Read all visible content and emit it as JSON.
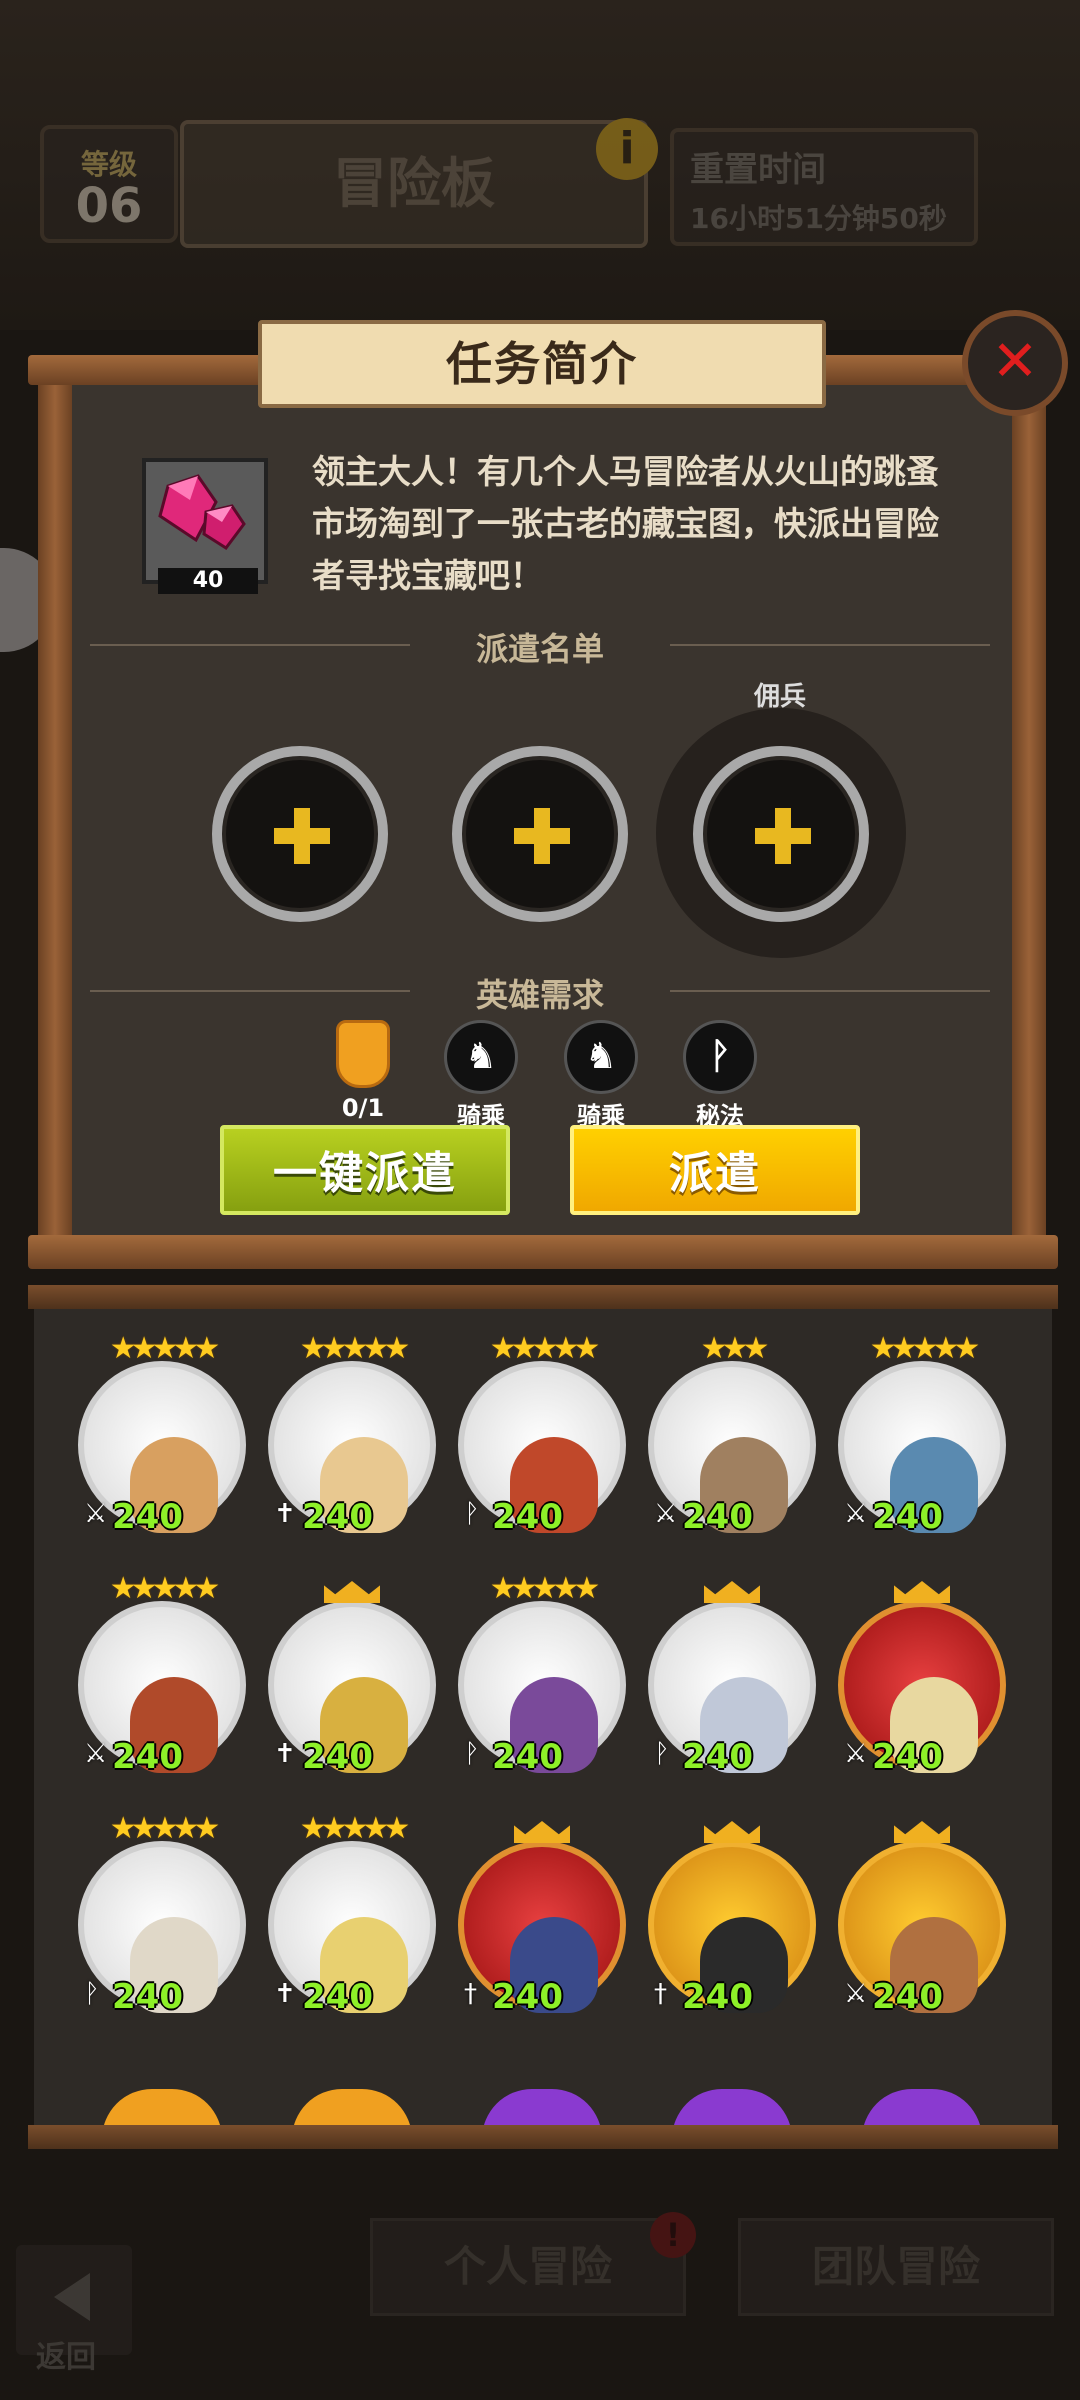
{
  "header": {
    "level_label": "等级",
    "level_value": "06",
    "board_title": "冒险板",
    "info_icon": "info-icon",
    "refresh_label": "重置时间",
    "refresh_time": "16小时51分钟50秒"
  },
  "dialog": {
    "title": "任务简介",
    "close_icon": "close-icon",
    "reward": {
      "icon": "pink-gem-icon",
      "count": "40"
    },
    "description": "领主大人！有几个人马冒险者从火山的跳蚤市场淘到了一张古老的藏宝图，快派出冒险者寻找宝藏吧！",
    "dispatch_list_label": "派遣名单",
    "mercenary_label": "佣兵",
    "hero_requirements_label": "英雄需求",
    "requirements": [
      {
        "icon": "orange-shield-icon",
        "label": "0/1"
      },
      {
        "icon": "horse-head-icon",
        "label": "骑乘"
      },
      {
        "icon": "horse-head-icon",
        "label": "骑乘"
      },
      {
        "icon": "magic-wand-icon",
        "label": "秘法"
      }
    ],
    "auto_dispatch_button": "一键派遣",
    "dispatch_button": "派遣"
  },
  "roster": [
    {
      "level": "240",
      "class_icon": "sword-icon",
      "stars": "★★★★★"
    },
    {
      "level": "240",
      "class_icon": "cross-icon",
      "stars": "★★★★★"
    },
    {
      "level": "240",
      "class_icon": "magic-icon",
      "stars": "★★★★★"
    },
    {
      "level": "240",
      "class_icon": "sword-icon",
      "stars": "★★★"
    },
    {
      "level": "240",
      "class_icon": "sword-icon",
      "stars": "★★★★★"
    },
    {
      "level": "240",
      "class_icon": "sword-icon",
      "stars": "★★★★★"
    },
    {
      "level": "240",
      "class_icon": "cross-icon",
      "stars": ""
    },
    {
      "level": "240",
      "class_icon": "magic-icon",
      "stars": "★★★★★"
    },
    {
      "level": "240",
      "class_icon": "magic-icon",
      "stars": ""
    },
    {
      "level": "240",
      "class_icon": "sword-icon",
      "stars": ""
    },
    {
      "level": "240",
      "class_icon": "magic-icon",
      "stars": "★★★★★"
    },
    {
      "level": "240",
      "class_icon": "cross-icon",
      "stars": "★★★★★"
    },
    {
      "level": "240",
      "class_icon": "dagger-icon",
      "stars": ""
    },
    {
      "level": "240",
      "class_icon": "dagger-icon",
      "stars": ""
    },
    {
      "level": "240",
      "class_icon": "sword-icon",
      "stars": ""
    }
  ],
  "footer": {
    "back_label": "返回",
    "tab_personal": "个人冒险",
    "tab_team": "团队冒险",
    "alert_badge": "!"
  },
  "colors": {
    "gold_accent": "#e8b820",
    "green_button": "#9ab818",
    "yellow_button": "#f8c000",
    "close_red": "#e01e1e",
    "level_green": "#8ef028"
  }
}
